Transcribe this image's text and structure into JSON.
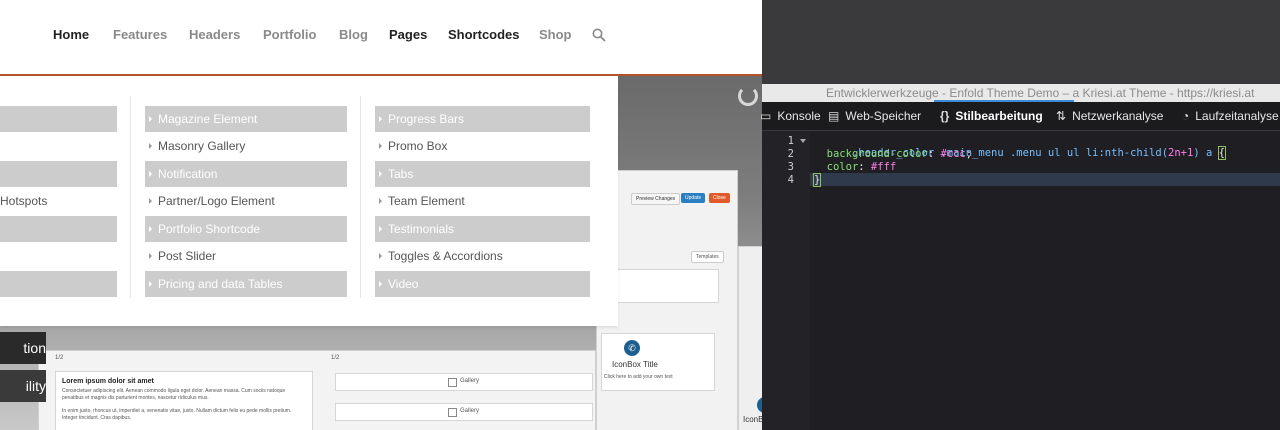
{
  "nav": {
    "items": [
      "Home",
      "Features",
      "Headers",
      "Portfolio",
      "Blog",
      "Pages",
      "Shortcodes",
      "Shop"
    ]
  },
  "mega_menu": {
    "col1": [
      "",
      "",
      "",
      "Hotspots",
      "",
      "",
      ""
    ],
    "col2": [
      "Magazine Element",
      "Masonry Gallery",
      "Notification",
      "Partner/Logo Element",
      "Portfolio Shortcode",
      "Post Slider",
      "Pricing and data Tables"
    ],
    "col3": [
      "Progress Bars",
      "Promo Box",
      "Tabs",
      "Team Element",
      "Testimonials",
      "Toggles & Accordions",
      "Video"
    ]
  },
  "hero": {
    "side_buttons": [
      "tion",
      "ility"
    ],
    "builder": {
      "preview_label": "Preview Changes",
      "update_label": "Update",
      "close_label": "Close",
      "templates_label": "Templates",
      "half_label_1": "1/2",
      "half_label_2": "1/2",
      "lorem_title": "Lorem ipsum dolor sit amet",
      "lorem_p1": "Consectetuer adipiscing elit. Aenean commodo ligula eget dolor. Aenean massa. Cum sociis natoque penatibus et magnis dis parturient montes, nascetur ridiculus mus.",
      "lorem_p2": "In enim justo, rhoncus ut, imperdiet a, venenatis vitae, justo. Nullam dictum felis eu pede mollis pretium. Integer tincidunt. Cras dapibus.",
      "gallery_1": "Gallery",
      "gallery_2": "Gallery",
      "iconbox_title": "IconBox Title",
      "iconbox_text": "Click here to add your own text",
      "iconbox_title_2": "IconBo"
    }
  },
  "devtools": {
    "window_title": "Entwicklerwerkzeuge - Enfold Theme Demo – a Kriesi.at Theme - https://kriesi.at",
    "tabs": [
      {
        "icon": "console-icon",
        "label": "Konsole"
      },
      {
        "icon": "storage-icon",
        "label": "Web-Speicher"
      },
      {
        "icon": "braces-icon",
        "label": "Stilbearbeitung"
      },
      {
        "icon": "network-icon",
        "label": "Netzwerkanalyse"
      },
      {
        "icon": "performance-icon",
        "label": "Laufzeitanalyse"
      }
    ],
    "active_tab": "Stilbearbeitung",
    "line_numbers": [
      "1",
      "2",
      "3",
      "4"
    ],
    "code": {
      "sel_a": ".header_color .main_menu .menu ul ul li",
      "sel_pseudo": ":nth-child(",
      "sel_arg": "2n+1",
      "sel_close": ") a ",
      "brace_open": "{",
      "prop1": "background-color",
      "val1": "#ccc",
      "prop2": "color",
      "val2": "#fff",
      "brace_close": "}"
    },
    "colors": {
      "accent_tab_underline": "#3d8cd8",
      "menu_highlight": "#cccccc",
      "nav_underline": "#b4532a"
    }
  }
}
